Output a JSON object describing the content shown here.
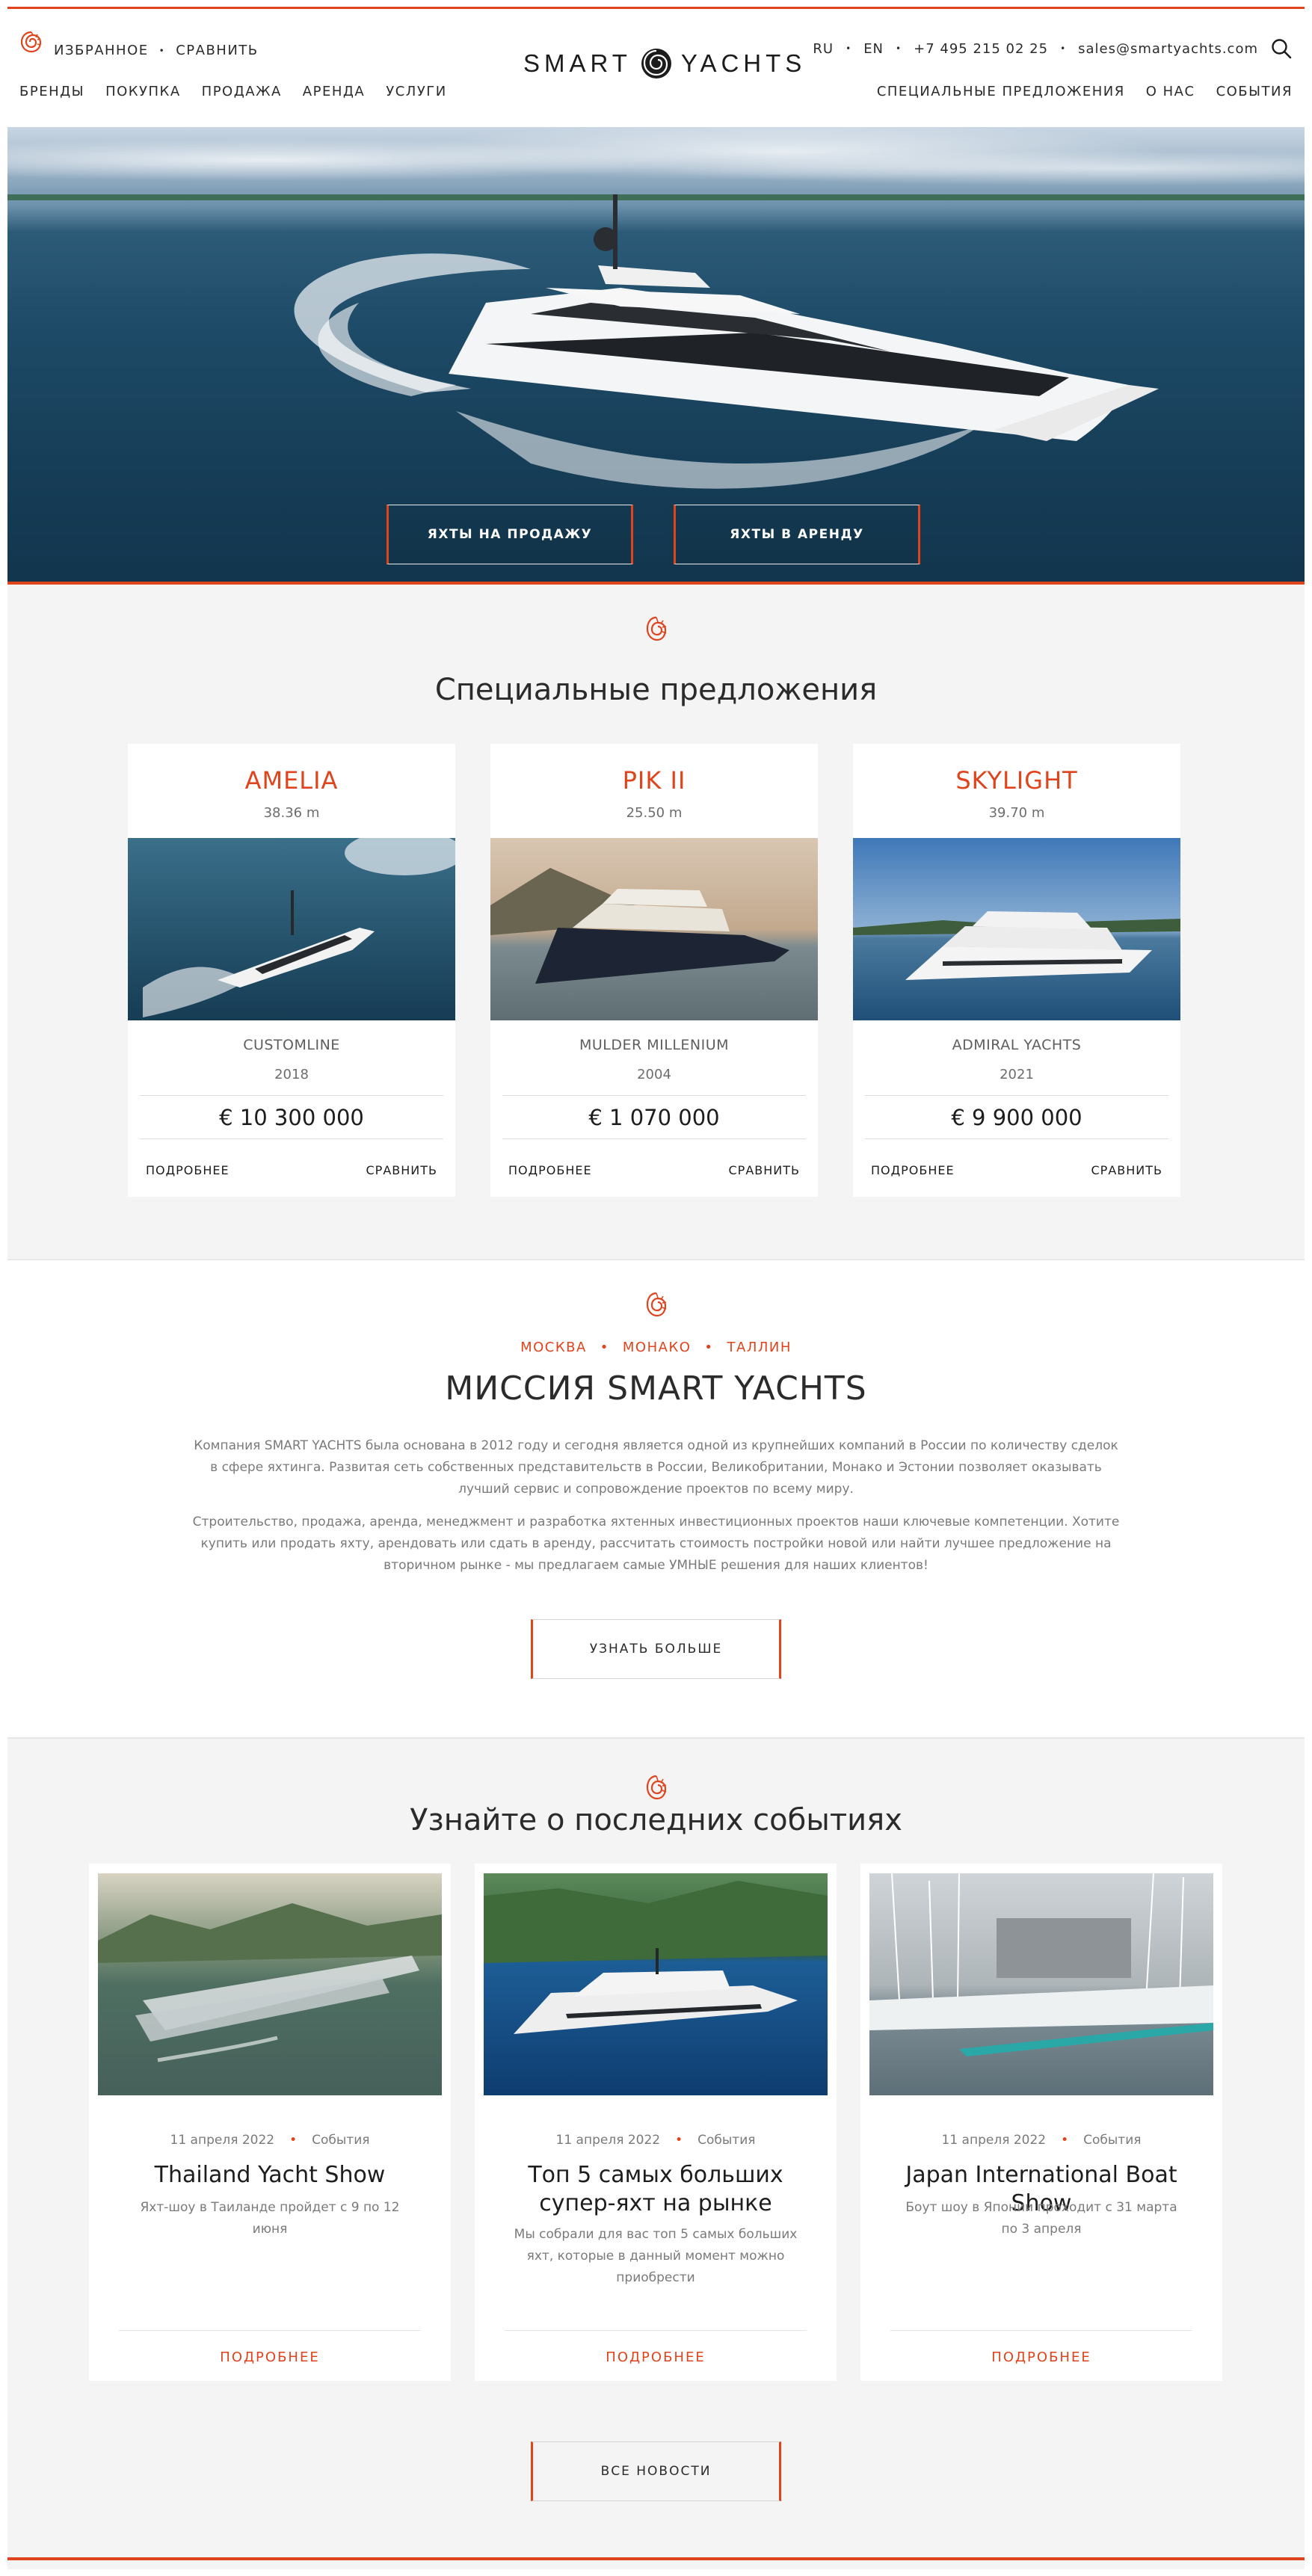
{
  "header": {
    "favorites": "ИЗБРАННОЕ",
    "compare": "СРАВНИТЬ",
    "nav_left": [
      "БРЕНДЫ",
      "ПОКУПКА",
      "ПРОДАЖА",
      "АРЕНДА",
      "УСЛУГИ"
    ],
    "brand_left": "SMART",
    "brand_right": "YACHTS",
    "lang_ru": "RU",
    "lang_en": "EN",
    "phone": "+7 495 215 02 25",
    "email": "sales@smartyachts.com",
    "nav_right": [
      "СПЕЦИАЛЬНЫЕ ПРЕДЛОЖЕНИЯ",
      "О НАС",
      "СОБЫТИЯ"
    ]
  },
  "hero": {
    "buy_button": "ЯХТЫ НА ПРОДАЖУ",
    "rent_button": "ЯХТЫ В АРЕНДУ"
  },
  "offers": {
    "title": "Специальные предложения",
    "items": [
      {
        "name": "AMELIA",
        "length": "38.36 m",
        "builder": "CUSTOMLINE",
        "year": "2018",
        "price": "€ 10 300 000",
        "more": "ПОДРОБНЕЕ",
        "compare": "СРАВНИТЬ"
      },
      {
        "name": "PIK II",
        "length": "25.50 m",
        "builder": "MULDER MILLENIUM",
        "year": "2004",
        "price": "€ 1 070 000",
        "more": "ПОДРОБНЕЕ",
        "compare": "СРАВНИТЬ"
      },
      {
        "name": "SKYLIGHT",
        "length": "39.70 m",
        "builder": "ADMIRAL YACHTS",
        "year": "2021",
        "price": "€ 9 900 000",
        "more": "ПОДРОБНЕЕ",
        "compare": "СРАВНИТЬ"
      }
    ]
  },
  "mission": {
    "cities": [
      "МОСКВА",
      "МОНАКО",
      "ТАЛЛИН"
    ],
    "title": "МИССИЯ SMART YACHTS",
    "paragraph1": "Компания SMART YACHTS была основана в 2012 году и сегодня является одной из крупнейших компаний в России по количеству сделок в сфере яхтинга. Развитая сеть собственных представительств в России, Великобритании, Монако и Эстонии позволяет оказывать лучший сервис и сопровождение проектов по всему миру.",
    "paragraph2": "Строительство, продажа, аренда, менеджмент и разработка яхтенных инвестиционных проектов наши ключевые компетенции. Хотите купить или продать яхту, арендовать или сдать в аренду, рассчитать стоимость постройки новой или найти лучшее предложение на вторичном рынке - мы предлагаем самые УМНЫЕ решения для наших клиентов!",
    "button": "УЗНАТЬ БОЛЬШЕ"
  },
  "news": {
    "title": "Узнайте о последних событиях",
    "items": [
      {
        "date": "11 апреля 2022",
        "category": "События",
        "title": "Thailand Yacht Show",
        "description": "Яхт-шоу в Таиланде пройдет с 9 по 12 июня",
        "more": "ПОДРОБНЕЕ"
      },
      {
        "date": "11 апреля 2022",
        "category": "События",
        "title": "Топ 5 самых больших супер-яхт на рынке",
        "description": "Мы собрали для вас топ 5 самых больших яхт, которые в данный момент можно приобрести",
        "more": "ПОДРОБНЕЕ"
      },
      {
        "date": "11 апреля 2022",
        "category": "События",
        "title": "Japan International Boat Show",
        "description": "Боут шоу в Японии проходит с 31 марта по 3 апреля",
        "more": "ПОДРОБНЕЕ"
      }
    ],
    "all_button": "ВСЕ НОВОСТИ"
  },
  "colors": {
    "accent": "#e0441d",
    "section_bg": "#f4f4f4",
    "text_dark": "#2b2b2b",
    "text_muted": "#7a7a7a"
  },
  "icons": [
    "shell-logo-icon",
    "search-icon"
  ]
}
